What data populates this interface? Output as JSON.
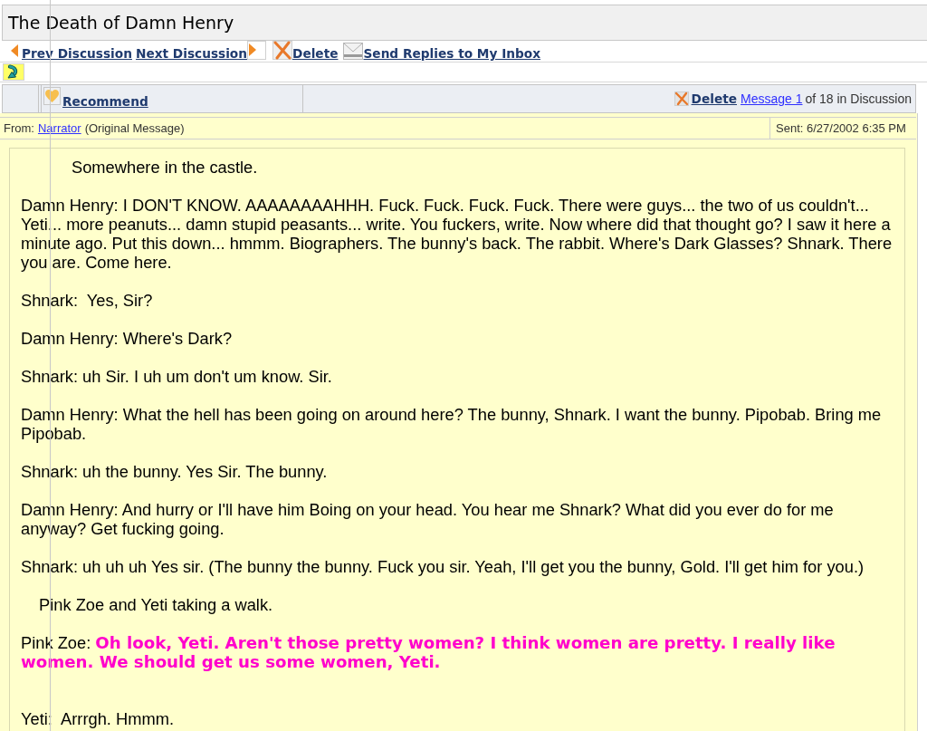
{
  "title": "The Death of Damn Henry",
  "toolbar": {
    "links": [
      {
        "kind": "prev",
        "label": "Prev Discussion"
      },
      {
        "kind": "next",
        "label": "Next Discussion"
      },
      {
        "kind": "delete",
        "label": "Delete"
      },
      {
        "kind": "inbox",
        "label": "Send Replies to My Inbox"
      }
    ]
  },
  "message_toolbar": {
    "recommend": "Recommend",
    "delete": "Delete",
    "message_link": "Message 1",
    "position": "of 18 in Discussion"
  },
  "header": {
    "from_label": "From:",
    "author": "Narrator",
    "note": "(Original Message)",
    "sent": "Sent: 6/27/2002 6:35 PM"
  },
  "paragraphs": [
    {
      "kind": "scene",
      "text": "Somewhere in the castle.",
      "gap_before": false
    },
    {
      "kind": "line",
      "text": "Damn Henry: I DON'T KNOW. AAAAAAAAHHH. Fuck. Fuck. Fuck. Fuck. There were guys... the two of us couldn't... Yeti... more peanuts... damn stupid peasants... write. You fuckers, write. Now where did that thought go? I saw it here a minute ago. Put this down... hmmm. Biographers. The bunny's back. The rabbit. Where's Dark Glasses? Shnark. There you are. Come here.",
      "gap_before": false
    },
    {
      "kind": "line",
      "text": "Shnark:  Yes, Sir?",
      "gap_before": false
    },
    {
      "kind": "line",
      "text": "Damn Henry: Where's Dark?",
      "gap_before": false
    },
    {
      "kind": "line",
      "text": "Shnark: uh Sir. I uh um don't um know. Sir.",
      "gap_before": false
    },
    {
      "kind": "line",
      "text": "Damn Henry: What the hell has been going on around here? The bunny, Shnark. I want the bunny. Pipobab. Bring me Pipobab.",
      "gap_before": false
    },
    {
      "kind": "line",
      "text": "Shnark: uh the bunny. Yes Sir. The bunny.",
      "gap_before": false
    },
    {
      "kind": "line",
      "text": "Damn Henry: And hurry or I'll have him Boing on your head. You hear me Shnark? What did you ever do for me anyway? Get fucking going.",
      "gap_before": false
    },
    {
      "kind": "line",
      "text": "Shnark: uh uh uh Yes sir. (The bunny the bunny. Fuck you sir. Yeah, I'll get you the bunny, Gold. I'll get him for you.)",
      "gap_before": false
    },
    {
      "kind": "aside",
      "text": "Pink Zoe and Yeti taking a walk.",
      "gap_before": false
    },
    {
      "kind": "line",
      "text": "Pink Zoe:",
      "speech": "Oh look, Yeti. Aren't those pretty women? I think women are pretty. I really like women. We should get us some women, Yeti.",
      "color": "#ff00cc",
      "gap_before": false
    },
    {
      "kind": "line",
      "text": "Yeti:  Arrrgh. Hmmm.",
      "gap_before": true
    }
  ]
}
